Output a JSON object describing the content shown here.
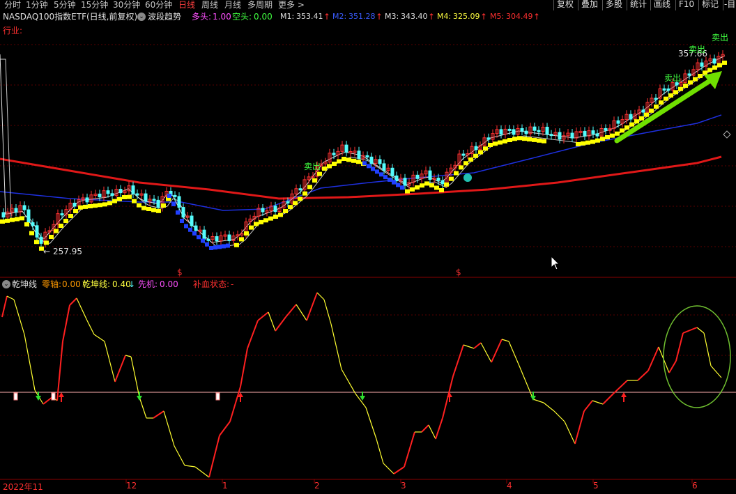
{
  "toolbar": {
    "periods": [
      "分时",
      "1分钟",
      "5分钟",
      "15分钟",
      "30分钟",
      "60分钟",
      "日线",
      "周线",
      "月线",
      "多周期",
      "更多 >"
    ],
    "active_period": "日线",
    "right_buttons": [
      "复权",
      "叠加",
      "多股",
      "统计",
      "画线",
      "F10",
      "标记",
      "-目"
    ]
  },
  "main_chart": {
    "title": "NASDAQ100指数ETF(日线,前复权)",
    "indicator": "波段趋势",
    "duotou_label": "多头:",
    "duotou_value": "1.00",
    "kongtou_label": "空头:",
    "kongtou_value": "0.00",
    "ma": [
      {
        "label": "M1:",
        "value": "353.41",
        "color": "#e0e0e0"
      },
      {
        "label": "M2:",
        "value": "351.28",
        "color": "#3a5cff"
      },
      {
        "label": "M3:",
        "value": "343.40",
        "color": "#e0e0e0"
      },
      {
        "label": "M4:",
        "value": "325.09",
        "color": "#ffff40"
      },
      {
        "label": "M5:",
        "value": "304.49",
        "color": "#ff3030"
      }
    ],
    "industry_label": "行业:",
    "low_label": "257.95",
    "high_label": "357.66",
    "sell_labels": [
      "卖出",
      "卖出",
      "卖出",
      "卖出"
    ],
    "s_markers": [
      "$",
      "$"
    ]
  },
  "indicator_panel": {
    "name": "乾坤线",
    "zero_axis_label": "零轴:",
    "zero_axis_value": "0.00",
    "qiankun_label": "乾坤线:",
    "qiankun_value": "0.40",
    "xianji_label": "先机:",
    "xianji_value": "0.00",
    "buxue_label": "补血状态:",
    "buxue_value": "-"
  },
  "x_axis": {
    "labels": [
      "2022年11",
      "12",
      "1",
      "2",
      "3",
      "4",
      "5",
      "6"
    ]
  },
  "colors": {
    "up": "#ff3232",
    "down": "#54fcfc",
    "ma_yellow": "#ffff00",
    "ma_blue": "#1e30e0",
    "ma_red": "#e01818",
    "bg": "#000000",
    "grid": "#5a0000"
  }
}
